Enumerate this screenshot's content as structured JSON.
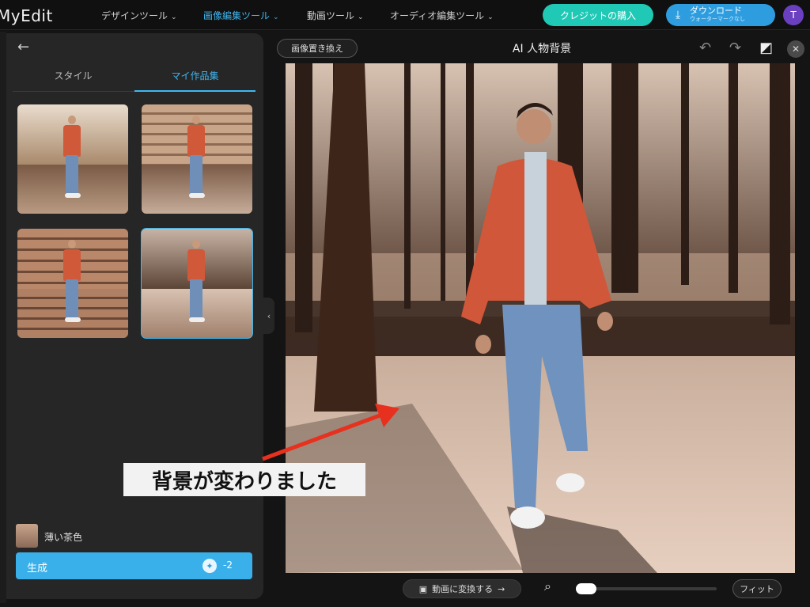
{
  "app": {
    "logo": "MyEdit"
  },
  "nav": [
    {
      "label": "デザインツール"
    },
    {
      "label": "画像編集ツール"
    },
    {
      "label": "動画ツール"
    },
    {
      "label": "オーディオ編集ツール"
    }
  ],
  "header": {
    "credit_label": "クレジットの購入",
    "download_label": "ダウンロード",
    "download_sub": "ウォーターマークなし",
    "avatar_initial": "T"
  },
  "panel": {
    "tabs": [
      {
        "label": "スタイル"
      },
      {
        "label": "マイ作品集"
      }
    ],
    "active_tab": "マイ作品集",
    "style_name": "薄い茶色",
    "generate_label": "生成",
    "generate_cost": "-2"
  },
  "editor": {
    "replace_label": "画像置き換え",
    "title": "AI 人物背景"
  },
  "bottom": {
    "video_label": "動画に変換する",
    "fit_label": "フィット",
    "zoom_fraction": 0
  },
  "annotation": {
    "text": "背景が変わりました"
  },
  "colors": {
    "accent": "#3fb8f0",
    "credit": "#1fc9b5",
    "download": "#2e9de0",
    "arrow": "#e8301e"
  }
}
